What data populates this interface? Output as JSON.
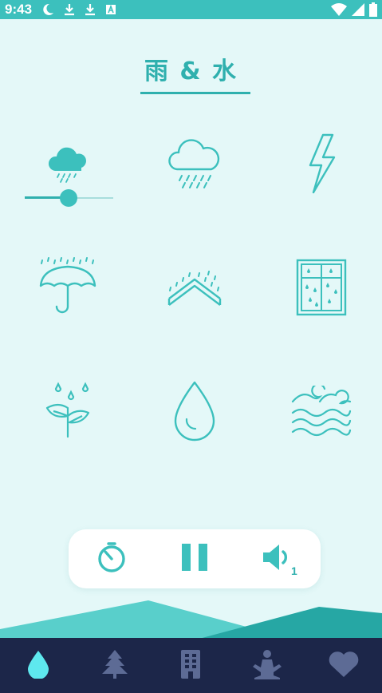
{
  "status": {
    "time": "9:43"
  },
  "page": {
    "title": "雨 & 水"
  },
  "sounds": [
    {
      "name": "light-rain",
      "icon": "light-rain-cloud-icon",
      "active": true,
      "volume": 0.5
    },
    {
      "name": "heavy-rain",
      "icon": "rain-cloud-icon",
      "active": false
    },
    {
      "name": "thunder",
      "icon": "lightning-icon",
      "active": false
    },
    {
      "name": "rain-on-umbrella",
      "icon": "umbrella-rain-icon",
      "active": false
    },
    {
      "name": "rain-on-roof",
      "icon": "roof-rain-icon",
      "active": false
    },
    {
      "name": "rain-on-window",
      "icon": "window-rain-icon",
      "active": false
    },
    {
      "name": "rain-on-leaves",
      "icon": "leaves-rain-icon",
      "active": false
    },
    {
      "name": "water-drop",
      "icon": "water-drop-icon",
      "active": false
    },
    {
      "name": "ocean-waves",
      "icon": "waves-icon",
      "active": false
    }
  ],
  "controls": {
    "timer": "timer-icon",
    "pause": "pause-icon",
    "volume": "volume-icon",
    "volume_count": "1"
  },
  "nav": [
    {
      "id": "rain",
      "icon": "water-drop-icon",
      "active": true
    },
    {
      "id": "nature",
      "icon": "tree-icon",
      "active": false
    },
    {
      "id": "city",
      "icon": "building-icon",
      "active": false
    },
    {
      "id": "meditation",
      "icon": "meditation-icon",
      "active": false
    },
    {
      "id": "favorites",
      "icon": "heart-icon",
      "active": false
    }
  ],
  "colors": {
    "accent": "#3cc0bd",
    "accent_dark": "#2fb0ae",
    "background": "#e4f8f8",
    "nav_bg": "#1c2649",
    "nav_icon": "#5d6b95",
    "nav_active": "#5ee8ee"
  }
}
